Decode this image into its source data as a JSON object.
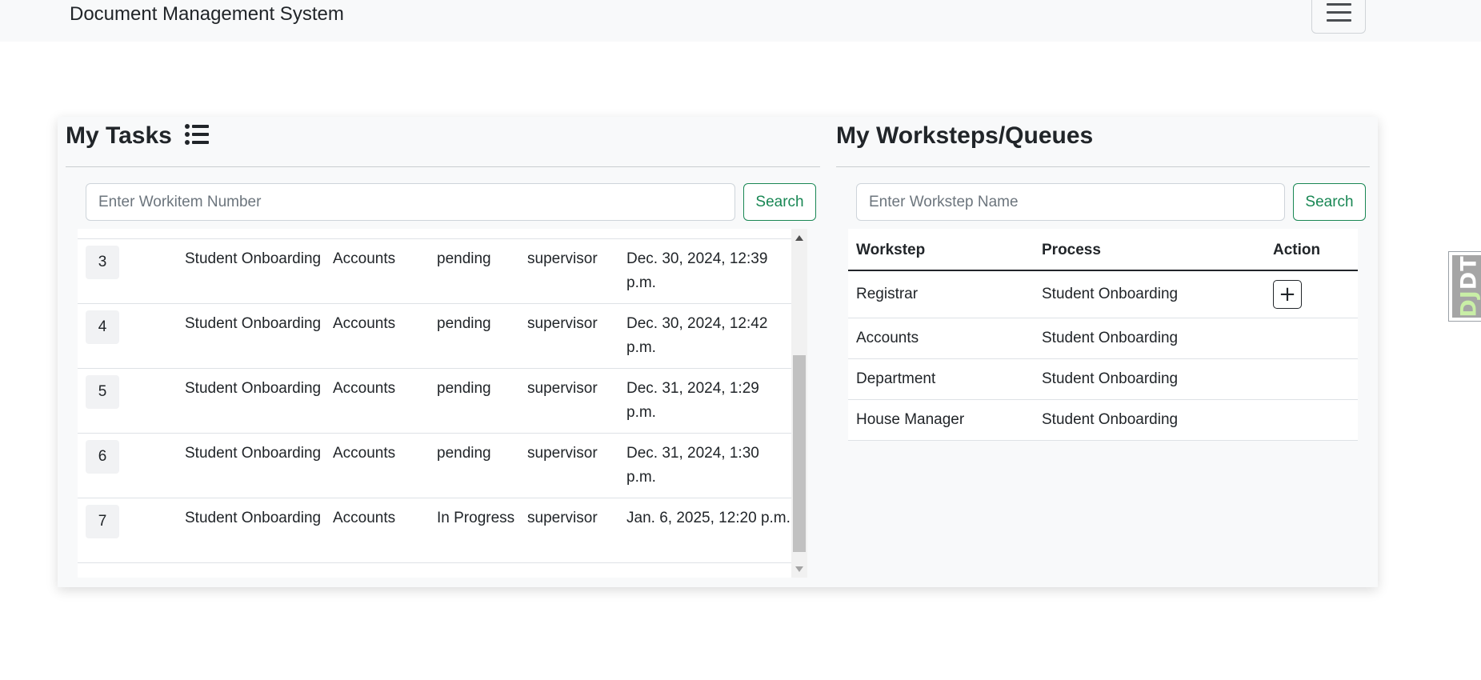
{
  "app": {
    "title": "Document Management System"
  },
  "tasks": {
    "title": "My Tasks",
    "search": {
      "placeholder": "Enter Workitem Number",
      "button": "Search"
    },
    "rows": [
      {
        "number": "3",
        "process": "Student Onboarding",
        "workstep": "Accounts",
        "status": "pending",
        "user": "supervisor",
        "date": "Dec. 30, 2024, 12:39 p.m."
      },
      {
        "number": "4",
        "process": "Student Onboarding",
        "workstep": "Accounts",
        "status": "pending",
        "user": "supervisor",
        "date": "Dec. 30, 2024, 12:42 p.m."
      },
      {
        "number": "5",
        "process": "Student Onboarding",
        "workstep": "Accounts",
        "status": "pending",
        "user": "supervisor",
        "date": "Dec. 31, 2024, 1:29 p.m."
      },
      {
        "number": "6",
        "process": "Student Onboarding",
        "workstep": "Accounts",
        "status": "pending",
        "user": "supervisor",
        "date": "Dec. 31, 2024, 1:30 p.m."
      },
      {
        "number": "7",
        "process": "Student Onboarding",
        "workstep": "Accounts",
        "status": "In Progress",
        "user": "supervisor",
        "date": "Jan. 6, 2025, 12:20 p.m."
      }
    ]
  },
  "worksteps": {
    "title": "My Worksteps/Queues",
    "search": {
      "placeholder": "Enter Workstep Name",
      "button": "Search"
    },
    "columns": [
      "Workstep",
      "Process",
      "Action"
    ],
    "rows": [
      {
        "workstep": "Registrar",
        "process": "Student Onboarding",
        "action": "+"
      },
      {
        "workstep": "Accounts",
        "process": "Student Onboarding",
        "action": ""
      },
      {
        "workstep": "Department",
        "process": "Student Onboarding",
        "action": ""
      },
      {
        "workstep": "House Manager",
        "process": "Student Onboarding",
        "action": ""
      }
    ]
  },
  "toolbar": {
    "djdt_label_1": "DJ",
    "djdt_label_2": "DT"
  },
  "colors": {
    "accent": "#198754",
    "navbar_bg": "#f8f9fa",
    "card_bg": "#f8f9fa"
  },
  "icons": {
    "menu": "hamburger-icon",
    "tasks": "list-icon"
  }
}
